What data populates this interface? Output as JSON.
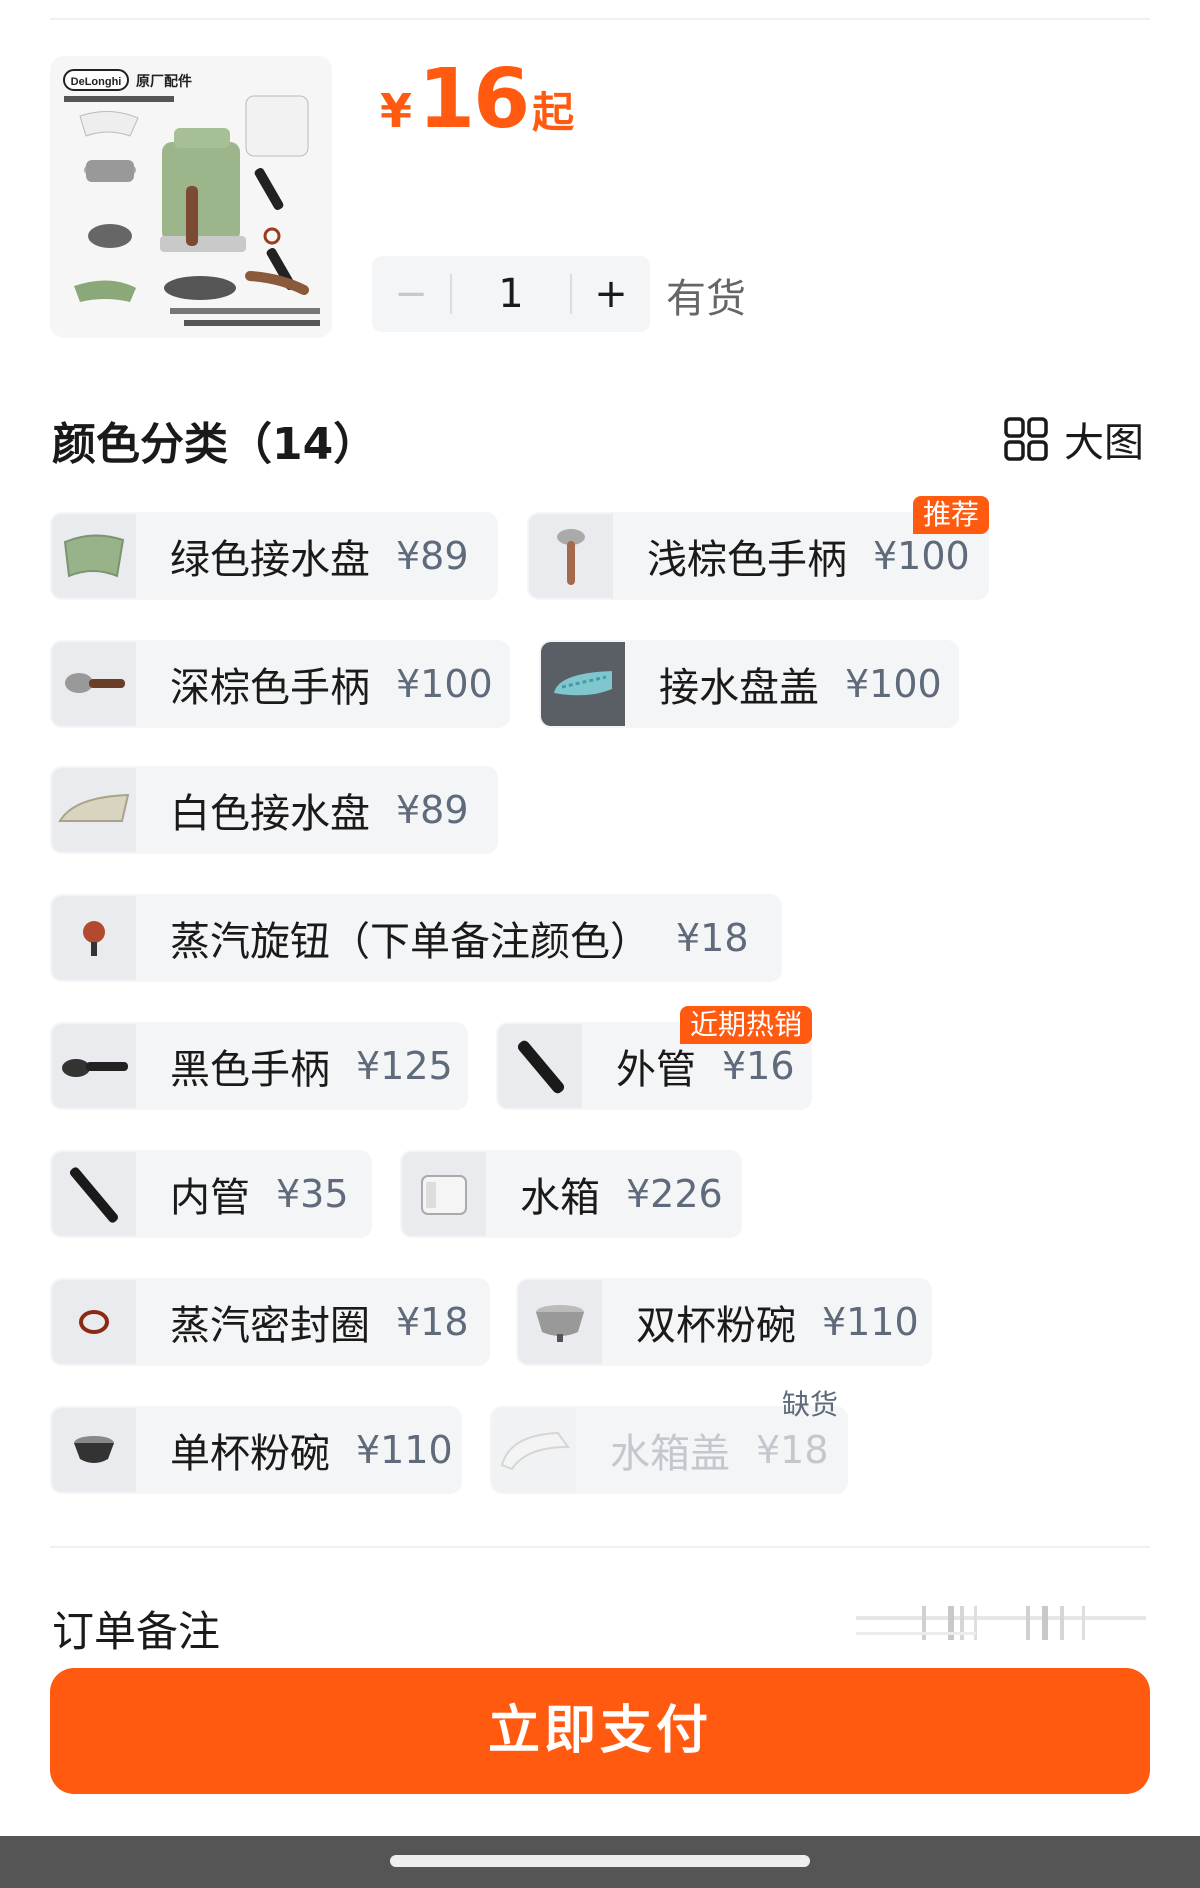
{
  "product": {
    "image_icon": "coffee-parts-photo",
    "brand_logo_text": "DeLonghi",
    "image_caption": "原厂配件",
    "price_currency": "¥",
    "price_value": "16",
    "price_suffix": "起",
    "quantity": "1",
    "minus": "−",
    "plus": "+",
    "stock": "有货"
  },
  "section": {
    "title": "颜色分类（14）",
    "big_view_label": "大图",
    "big_view_icon": "grid-icon"
  },
  "options": [
    {
      "name": "绿色接水盘",
      "price": "¥89",
      "icon": "green-drip-tray"
    },
    {
      "name": "浅棕色手柄",
      "price": "¥100",
      "tag": "推荐",
      "icon": "light-brown-handle"
    },
    {
      "name": "深棕色手柄",
      "price": "¥100",
      "icon": "dark-brown-handle"
    },
    {
      "name": "接水盘盖",
      "price": "¥100",
      "icon": "drip-tray-cover"
    },
    {
      "name": "白色接水盘",
      "price": "¥89",
      "icon": "white-drip-tray"
    },
    {
      "name": "蒸汽旋钮（下单备注颜色）",
      "price": "¥18",
      "icon": "steam-knob"
    },
    {
      "name": "黑色手柄",
      "price": "¥125",
      "icon": "black-handle"
    },
    {
      "name": "外管",
      "price": "¥16",
      "tag": "近期热销",
      "icon": "outer-tube"
    },
    {
      "name": "内管",
      "price": "¥35",
      "icon": "inner-tube"
    },
    {
      "name": "水箱",
      "price": "¥226",
      "icon": "water-tank"
    },
    {
      "name": "蒸汽密封圈",
      "price": "¥18",
      "icon": "steam-seal-ring"
    },
    {
      "name": "双杯粉碗",
      "price": "¥110",
      "icon": "double-filter-basket"
    },
    {
      "name": "单杯粉碗",
      "price": "¥110",
      "icon": "single-filter-basket"
    },
    {
      "name": "水箱盖",
      "price": "¥18",
      "tag": "缺货",
      "disabled": true,
      "icon": "water-tank-lid"
    }
  ],
  "order_note": {
    "label": "订单备注"
  },
  "pay_button": "立即支付",
  "colors": {
    "accent": "#ff5a10",
    "chip_bg": "#f4f5f7",
    "price_gray": "#5f6a7a"
  }
}
